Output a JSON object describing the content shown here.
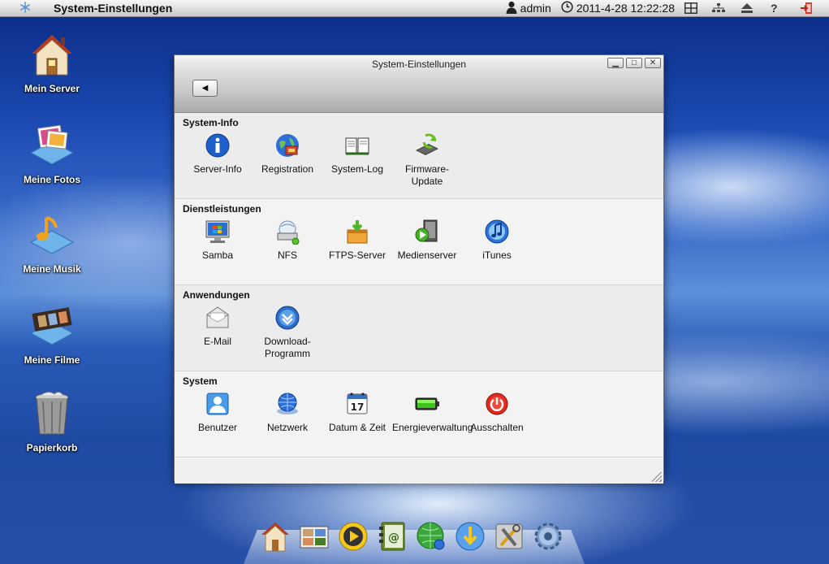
{
  "topbar": {
    "title": "System-Einstellungen",
    "user": "admin",
    "datetime": "2011-4-28 12:22:28",
    "help": "?"
  },
  "desktop": [
    {
      "label": "Mein Server",
      "icon": "house-icon"
    },
    {
      "label": "Meine Fotos",
      "icon": "photos-icon"
    },
    {
      "label": "Meine Musik",
      "icon": "music-icon"
    },
    {
      "label": "Meine Filme",
      "icon": "film-icon"
    },
    {
      "label": "Papierkorb",
      "icon": "trash-icon"
    }
  ],
  "window": {
    "title": "System-Einstellungen",
    "sections": [
      {
        "title": "System-Info",
        "items": [
          {
            "label": "Server-Info",
            "icon": "info-icon"
          },
          {
            "label": "Registration",
            "icon": "registration-globe-icon"
          },
          {
            "label": "System-Log",
            "icon": "log-book-icon"
          },
          {
            "label": "Firmware-\nUpdate",
            "icon": "firmware-update-icon"
          }
        ]
      },
      {
        "title": "Dienstleistungen",
        "items": [
          {
            "label": "Samba",
            "icon": "samba-monitor-icon"
          },
          {
            "label": "NFS",
            "icon": "nfs-drive-icon"
          },
          {
            "label": "FTPS-Server",
            "icon": "ftps-box-icon"
          },
          {
            "label": "Medienserver",
            "icon": "mediaserver-icon"
          },
          {
            "label": "iTunes",
            "icon": "itunes-icon"
          }
        ]
      },
      {
        "title": "Anwendungen",
        "items": [
          {
            "label": "E-Mail",
            "icon": "mail-envelope-icon"
          },
          {
            "label": "Download-\nProgramm",
            "icon": "download-icon"
          }
        ]
      },
      {
        "title": "System",
        "items": [
          {
            "label": "Benutzer",
            "icon": "user-icon"
          },
          {
            "label": "Netzwerk",
            "icon": "network-globe-icon"
          },
          {
            "label": "Datum & Zeit",
            "icon": "calendar-icon"
          },
          {
            "label": "Energieverwaltung",
            "icon": "battery-icon"
          },
          {
            "label": "Ausschalten",
            "icon": "power-icon"
          }
        ]
      }
    ]
  },
  "calendar_day": "17",
  "dock": [
    {
      "icon": "home-dock-icon"
    },
    {
      "icon": "photo-dock-icon"
    },
    {
      "icon": "player-dock-icon"
    },
    {
      "icon": "contacts-dock-icon"
    },
    {
      "icon": "network-dock-icon"
    },
    {
      "icon": "download-dock-icon"
    },
    {
      "icon": "tools-dock-icon"
    },
    {
      "icon": "settings-dock-icon"
    }
  ]
}
